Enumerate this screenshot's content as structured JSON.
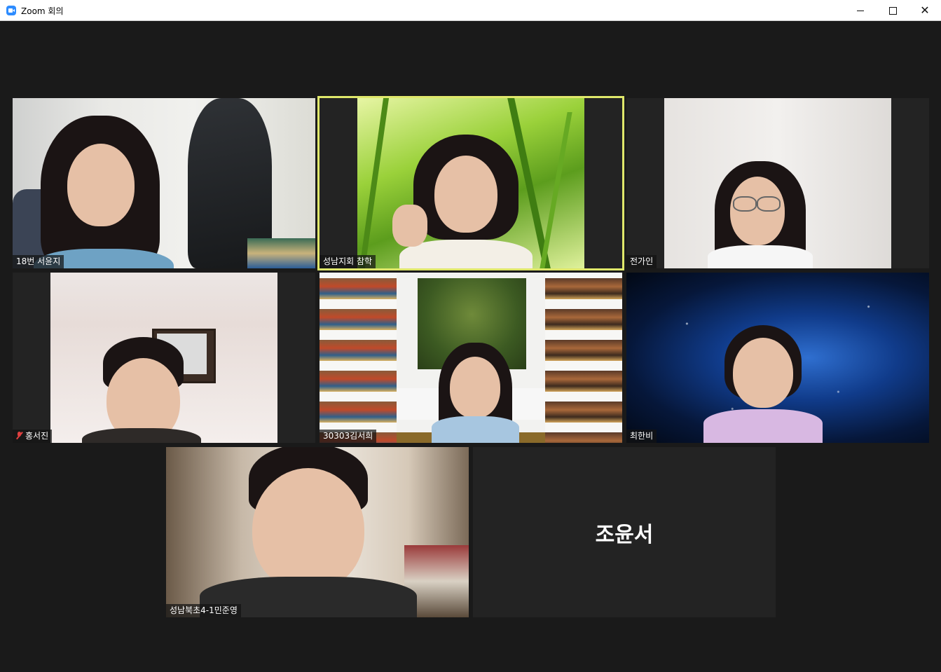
{
  "window": {
    "title": "Zoom 회의",
    "icon": "zoom-camera-icon",
    "controls": [
      "minimize-icon",
      "maximize-icon",
      "close-icon"
    ]
  },
  "colors": {
    "background": "#1a1a1a",
    "active_speaker_border": "#dfe76a",
    "muted_icon": "#e04040"
  },
  "participants": [
    {
      "name": "18번 서윤지",
      "video": true,
      "muted": false,
      "active_speaker": false
    },
    {
      "name": "성남지회 참학",
      "video": true,
      "muted": false,
      "active_speaker": true
    },
    {
      "name": "전가인",
      "video": true,
      "muted": false,
      "active_speaker": false
    },
    {
      "name": "홍서진",
      "video": true,
      "muted": true,
      "active_speaker": false
    },
    {
      "name": "30303김서희",
      "video": true,
      "muted": false,
      "active_speaker": false
    },
    {
      "name": "최한비",
      "video": true,
      "muted": false,
      "active_speaker": false
    },
    {
      "name": "성남북초4-1민준영",
      "video": true,
      "muted": false,
      "active_speaker": false
    },
    {
      "name": "조윤서",
      "video": false,
      "muted": false,
      "active_speaker": false
    }
  ]
}
